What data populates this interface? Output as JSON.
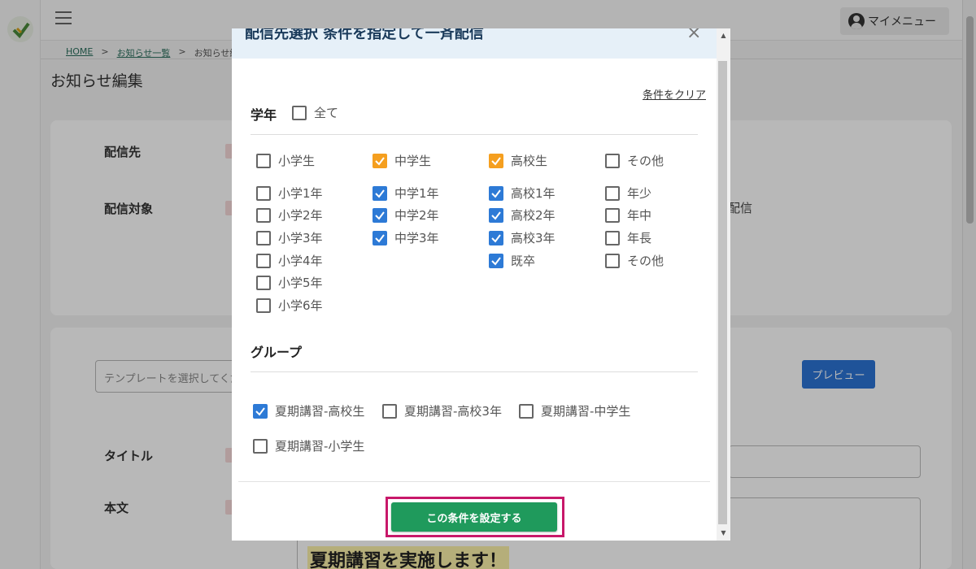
{
  "app": {
    "menu_label": "マイメニュー",
    "breadcrumb": [
      "HOME",
      "お知らせ一覧",
      "お知らせ編集"
    ],
    "page_title": "お知らせ編集",
    "labels": {
      "recipient": "配信先",
      "target": "配信対象",
      "title": "タイトル",
      "body": "本文"
    },
    "bg_distribute_text": "配信",
    "template_placeholder": "テンプレートを選択してください",
    "preview_label": "プレビュー",
    "body_headline": "夏期講習を実施します！"
  },
  "modal": {
    "title": "配信先選択 条件を指定して一斉配信",
    "clear_link": "条件をクリア",
    "grade_section": {
      "heading": "学年",
      "all_label": "全て",
      "all_checked": false,
      "categories": [
        {
          "label": "小学生",
          "checked": false,
          "style": "none"
        },
        {
          "label": "中学生",
          "checked": true,
          "style": "orange"
        },
        {
          "label": "高校生",
          "checked": true,
          "style": "orange"
        },
        {
          "label": "その他",
          "checked": false,
          "style": "none"
        }
      ],
      "columns": [
        [
          {
            "label": "小学1年",
            "checked": false
          },
          {
            "label": "小学2年",
            "checked": false
          },
          {
            "label": "小学3年",
            "checked": false
          },
          {
            "label": "小学4年",
            "checked": false
          },
          {
            "label": "小学5年",
            "checked": false
          },
          {
            "label": "小学6年",
            "checked": false
          }
        ],
        [
          {
            "label": "中学1年",
            "checked": true
          },
          {
            "label": "中学2年",
            "checked": true
          },
          {
            "label": "中学3年",
            "checked": true
          }
        ],
        [
          {
            "label": "高校1年",
            "checked": true
          },
          {
            "label": "高校2年",
            "checked": true
          },
          {
            "label": "高校3年",
            "checked": true
          },
          {
            "label": "既卒",
            "checked": true
          }
        ],
        [
          {
            "label": "年少",
            "checked": false
          },
          {
            "label": "年中",
            "checked": false
          },
          {
            "label": "年長",
            "checked": false
          },
          {
            "label": "その他",
            "checked": false
          }
        ]
      ]
    },
    "group_section": {
      "heading": "グループ",
      "items": [
        {
          "label": "夏期講習-高校生",
          "checked": true
        },
        {
          "label": "夏期講習-高校3年",
          "checked": false
        },
        {
          "label": "夏期講習-中学生",
          "checked": false
        },
        {
          "label": "夏期講習-小学生",
          "checked": false
        }
      ]
    },
    "submit_label": "この条件を設定する"
  },
  "colors": {
    "check_blue": "#2d7ad6",
    "check_orange": "#f59f1f",
    "submit_green": "#1f9a5c",
    "highlight_magenta": "#c8186a",
    "header_bg": "#e6f0f8"
  }
}
